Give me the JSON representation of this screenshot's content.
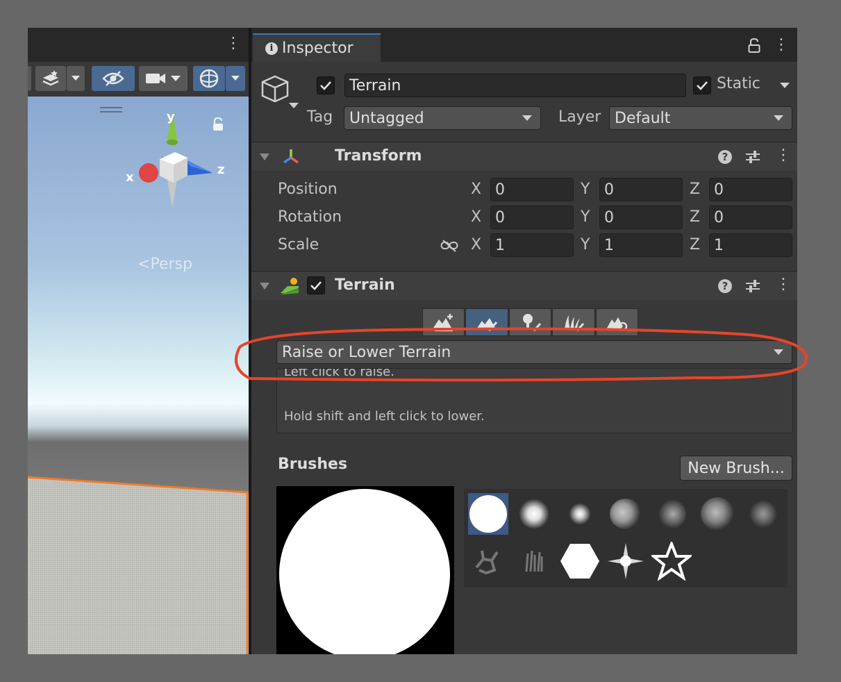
{
  "scene": {
    "gizmo": {
      "x_label": "x",
      "y_label": "y",
      "z_label": "z"
    },
    "persp_label": "Persp"
  },
  "inspector": {
    "tab_label": "Inspector",
    "object": {
      "name": "Terrain",
      "active": true,
      "static_label": "Static",
      "static_checked": true,
      "tag_label": "Tag",
      "tag_value": "Untagged",
      "layer_label": "Layer",
      "layer_value": "Default"
    },
    "transform": {
      "title": "Transform",
      "rows": [
        {
          "label": "Position",
          "x": "0",
          "y": "0",
          "z": "0"
        },
        {
          "label": "Rotation",
          "x": "0",
          "y": "0",
          "z": "0"
        },
        {
          "label": "Scale",
          "x": "1",
          "y": "1",
          "z": "1"
        }
      ],
      "axis_x": "X",
      "axis_y": "Y",
      "axis_z": "Z"
    },
    "terrain": {
      "title": "Terrain",
      "enabled": true,
      "tools": [
        "create-neighbor-terrains",
        "paint-terrain",
        "paint-trees",
        "paint-details",
        "terrain-settings"
      ],
      "active_tool_index": 1,
      "mode_value": "Raise or Lower Terrain",
      "help_line1": "Left click to raise.",
      "help_line2": "Hold shift and left click to lower.",
      "brushes_label": "Brushes",
      "new_brush_label": "New Brush...",
      "selected_brush_index": 0
    }
  },
  "annotation": {
    "color": "#e8442a"
  },
  "colors": {
    "panel_bg": "#383838",
    "header_bg": "#3e3e3e",
    "accent_tab": "#3a79bb",
    "selected": "#3e5a85"
  }
}
